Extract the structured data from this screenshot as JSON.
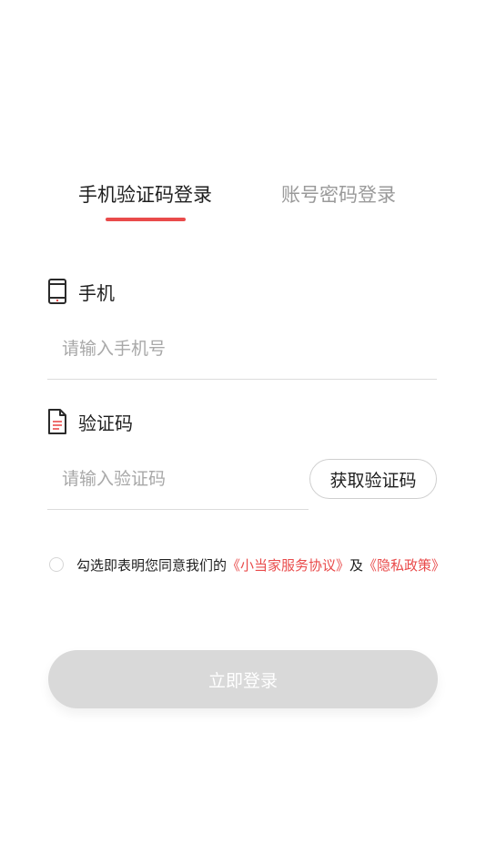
{
  "tabs": {
    "sms_login": "手机验证码登录",
    "password_login": "账号密码登录",
    "active": "sms_login"
  },
  "phone": {
    "label": "手机",
    "icon": "phone-icon",
    "placeholder": "请输入手机号",
    "value": ""
  },
  "code": {
    "label": "验证码",
    "icon": "document-icon",
    "placeholder": "请输入验证码",
    "value": "",
    "button_label": "获取验证码"
  },
  "agreement": {
    "checked": false,
    "prefix": "勾选即表明您同意我们的",
    "terms_link": "《小当家服务协议》",
    "conjunction": "及",
    "privacy_link": "《隐私政策》"
  },
  "login_button": {
    "label": "立即登录",
    "enabled": false
  },
  "colors": {
    "accent": "#e94b4b",
    "disabled_button": "#d9d9d9",
    "placeholder": "#a8a8a8",
    "inactive_tab": "#9a9a9a"
  }
}
